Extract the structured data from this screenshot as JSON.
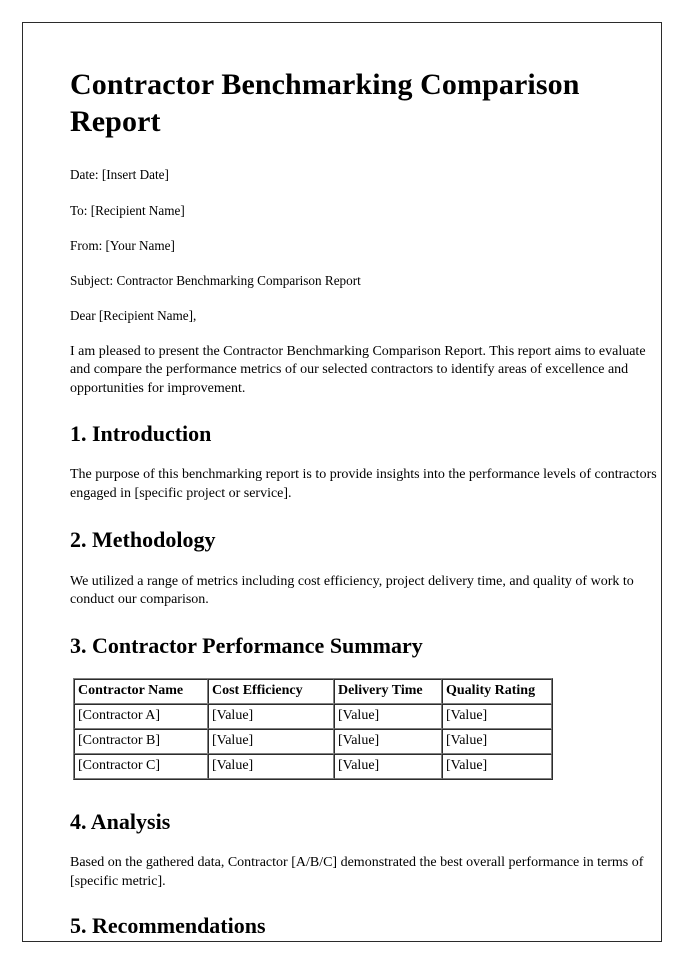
{
  "document": {
    "title": "Contractor Benchmarking Comparison Report",
    "meta": [
      {
        "key": "date",
        "text": "Date: [Insert Date]"
      },
      {
        "key": "to",
        "text": "To: [Recipient Name]"
      },
      {
        "key": "from",
        "text": "From: [Your Name]"
      },
      {
        "key": "subject",
        "text": "Subject: Contractor Benchmarking Comparison Report"
      },
      {
        "key": "salutation",
        "text": "Dear [Recipient Name],"
      }
    ],
    "intro_paragraph": "I am pleased to present the Contractor Benchmarking Comparison Report. This report aims to evaluate and compare the performance metrics of our selected contractors to identify areas of excellence and opportunities for improvement.",
    "sections": [
      {
        "number": "1",
        "heading": "1. Introduction",
        "body": "The purpose of this benchmarking report is to provide insights into the performance levels of contractors engaged in [specific project or service]."
      },
      {
        "number": "2",
        "heading": "2. Methodology",
        "body": "We utilized a range of metrics including cost efficiency, project delivery time, and quality of work to conduct our comparison."
      },
      {
        "number": "3",
        "heading": "3. Contractor Performance Summary",
        "body": ""
      },
      {
        "number": "4",
        "heading": "4. Analysis",
        "body": "Based on the gathered data, Contractor [A/B/C] demonstrated the best overall performance in terms of [specific metric]."
      },
      {
        "number": "5",
        "heading": "5. Recommendations",
        "body": ""
      }
    ],
    "summary_table": {
      "headers": [
        "Contractor Name",
        "Cost Efficiency",
        "Delivery Time",
        "Quality Rating"
      ],
      "rows": [
        [
          "[Contractor A]",
          "[Value]",
          "[Value]",
          "[Value]"
        ],
        [
          "[Contractor B]",
          "[Value]",
          "[Value]",
          "[Value]"
        ],
        [
          "[Contractor C]",
          "[Value]",
          "[Value]",
          "[Value]"
        ]
      ]
    },
    "colors": {
      "text": "#000000",
      "page_border": "#2b2b2b",
      "table_border": "#808080",
      "background": "#ffffff"
    }
  }
}
